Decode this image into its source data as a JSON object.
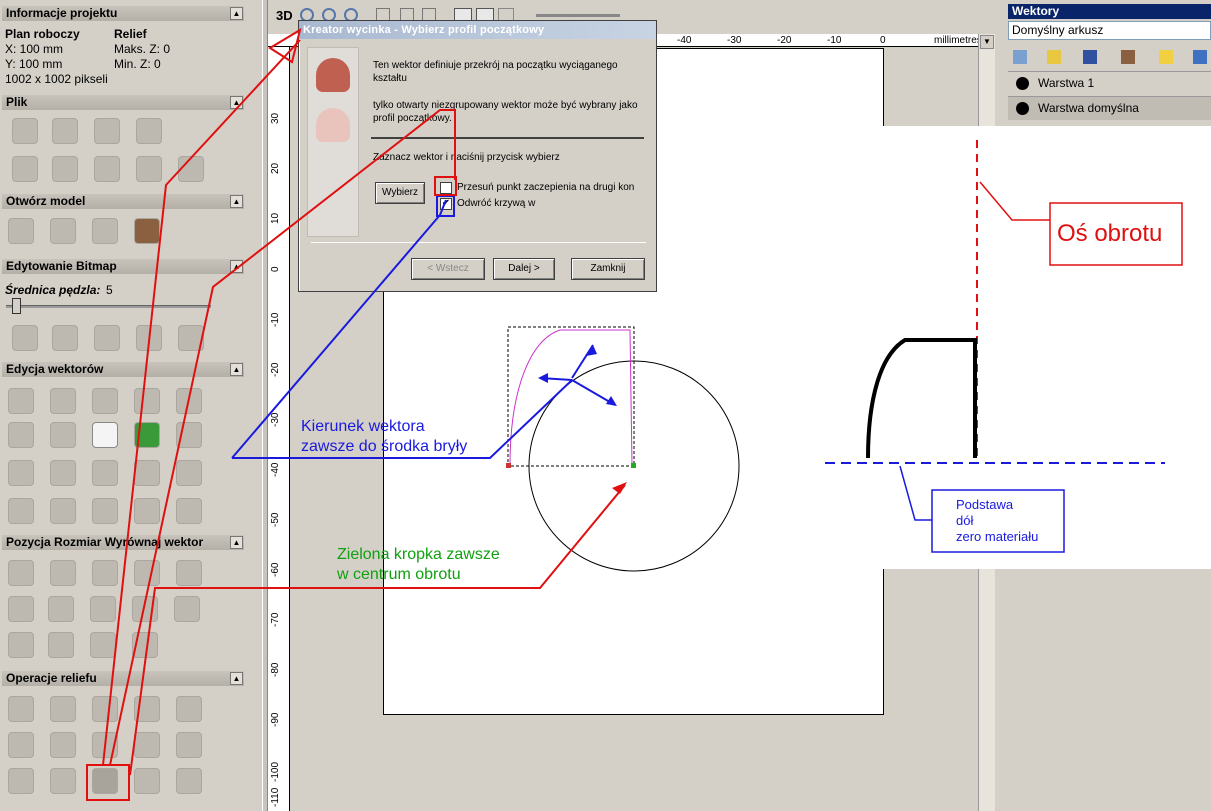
{
  "left_panel": {
    "project_info": {
      "title": "Informacje projektu",
      "plan_label": "Plan roboczy",
      "relief_label": "Relief",
      "x_value": "X: 100 mm",
      "y_value": "Y: 100 mm",
      "max_z": "Maks. Z: 0",
      "min_z": "Min. Z: 0",
      "pixels": "1002 x 1002 pikseli"
    },
    "sections": {
      "file": "Plik",
      "open_model": "Otwórz model",
      "bitmap_edit": "Edytowanie Bitmap",
      "vector_edit": "Edycja wektorów",
      "position": "Pozycja Rozmiar Wyrównaj wektor",
      "relief_ops": "Operacje reliefu"
    },
    "brush_label": "Średnica pędzla:",
    "brush_value": "5"
  },
  "toolbar": {
    "mode_3d": "3D"
  },
  "ruler": {
    "unit": "millimetres",
    "top_ticks": [
      "-40",
      "-30",
      "-20",
      "-10",
      "0"
    ],
    "left_ticks": [
      "30",
      "20",
      "10",
      "0",
      "-10",
      "-20",
      "-30",
      "-40",
      "-50",
      "-60",
      "-70",
      "-80",
      "-90",
      "-100",
      "-110"
    ]
  },
  "right_panel": {
    "title": "Wektory",
    "sheet": "Domyślny arkusz",
    "layers": [
      "Warstwa 1",
      "Warstwa domyślna"
    ]
  },
  "dialog": {
    "title": "Kreator wycinka - Wybierz profil początkowy",
    "text1": "Ten wektor definiuje przekrój na początku wyciąganego kształtu",
    "text2": "tylko otwarty niezgrupowany wektor może być wybrany jako profil początkowy.",
    "text3": "Zaznacz wektor i naciśnij przycisk wybierz",
    "select_btn": "Wybierz",
    "opt1": "Przesuń punkt zaczepienia na drugi kon",
    "opt2": "Odwróć krzywą w",
    "opt1_checked": false,
    "opt2_checked": true,
    "back_btn": "< Wstecz",
    "next_btn": "Dalej >",
    "close_btn": "Zamknij"
  },
  "annotations": {
    "vector_direction": [
      "Kierunek wektora",
      "zawsze do środka bryły"
    ],
    "green_dot": [
      "Zielona kropka zawsze",
      "w centrum obrotu"
    ],
    "axis": "Oś obrotu",
    "base": [
      "Podstawa",
      "dół",
      "zero materiału"
    ]
  },
  "colors": {
    "red": "#e01010",
    "blue": "#1a1adf",
    "green": "#10a010",
    "magenta": "#cc33cc",
    "title_bg": "#0a246a"
  }
}
